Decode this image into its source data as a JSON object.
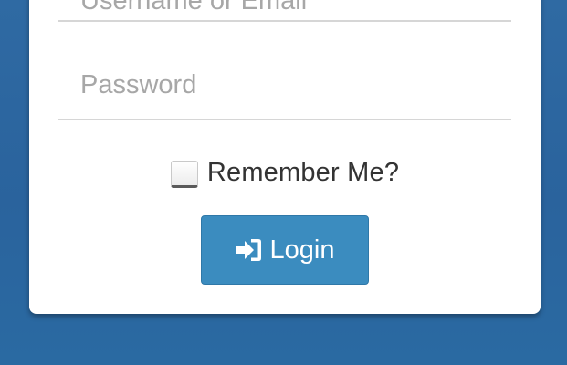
{
  "login_form": {
    "username": {
      "placeholder": "Username or Email",
      "value": ""
    },
    "password": {
      "placeholder": "Password",
      "value": ""
    },
    "remember_me": {
      "label": "Remember Me?",
      "checked": false
    },
    "login_button": {
      "label": "Login",
      "icon": "sign-in-icon"
    }
  },
  "colors": {
    "background": "#2a639d",
    "button": "#3b8cbf",
    "card": "#ffffff"
  }
}
